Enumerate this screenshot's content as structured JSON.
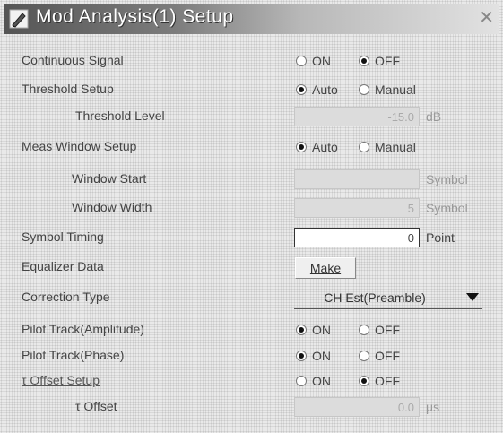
{
  "window": {
    "title": "Mod Analysis(1) Setup"
  },
  "rows": {
    "continuous_signal": {
      "label": "Continuous Signal",
      "on": "ON",
      "off": "OFF",
      "selected": "OFF"
    },
    "threshold_setup": {
      "label": "Threshold Setup",
      "auto": "Auto",
      "manual": "Manual",
      "selected": "Auto"
    },
    "threshold_level": {
      "label": "Threshold Level",
      "value": "-15.0",
      "unit": "dB"
    },
    "meas_window_setup": {
      "label": "Meas Window Setup",
      "auto": "Auto",
      "manual": "Manual",
      "selected": "Auto"
    },
    "window_start": {
      "label": "Window Start",
      "value": "",
      "unit": "Symbol"
    },
    "window_width": {
      "label": "Window Width",
      "value": "5",
      "unit": "Symbol"
    },
    "symbol_timing": {
      "label": "Symbol Timing",
      "value": "0",
      "unit": "Point"
    },
    "equalizer_data": {
      "label": "Equalizer Data",
      "button": "Make"
    },
    "correction_type": {
      "label": "Correction Type",
      "value": "CH Est(Preamble)"
    },
    "pilot_track_amplitude": {
      "label": "Pilot Track(Amplitude)",
      "on": "ON",
      "off": "OFF",
      "selected": "ON"
    },
    "pilot_track_phase": {
      "label": "Pilot Track(Phase)",
      "on": "ON",
      "off": "OFF",
      "selected": "ON"
    },
    "offset_setup": {
      "label": "τ  Offset Setup",
      "on": "ON",
      "off": "OFF",
      "selected": "OFF"
    },
    "offset": {
      "label": "τ  Offset",
      "value": "0.0",
      "unit": "μs"
    }
  }
}
